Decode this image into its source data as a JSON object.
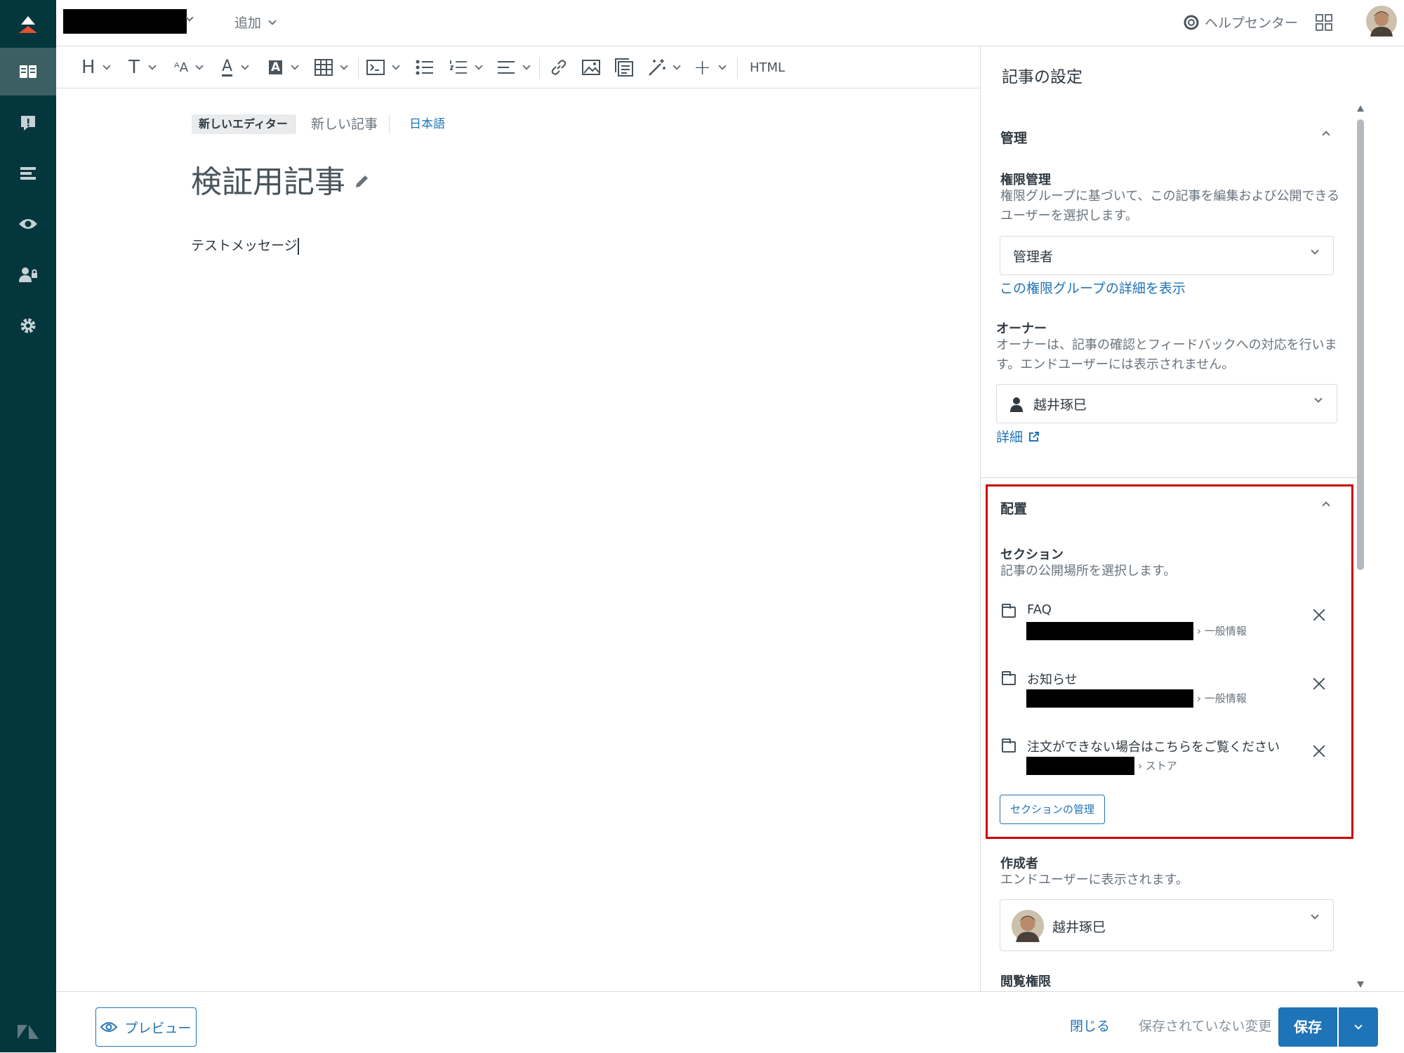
{
  "topbar": {
    "add_label": "追加",
    "help_label": "ヘルプセンター"
  },
  "toolbar": {
    "html_label": "HTML"
  },
  "editor": {
    "badge": "新しいエディター",
    "status": "新しい記事",
    "language": "日本語",
    "title": "検証用記事",
    "body": "テストメッセージ"
  },
  "panel": {
    "title": "記事の設定",
    "management": {
      "heading": "管理",
      "permission_label": "権限管理",
      "permission_desc": "権限グループに基づいて、この記事を編集および公開できるユーザーを選択します。",
      "permission_value": "管理者",
      "permission_link": "この権限グループの詳細を表示",
      "owner_label": "オーナー",
      "owner_desc": "オーナーは、記事の確認とフィードバックへの対応を行います。エンドユーザーには表示されません。",
      "owner_value": "越井琢巳",
      "owner_link": "詳細"
    },
    "placement": {
      "heading": "配置",
      "section_label": "セクション",
      "section_desc": "記事の公開場所を選択します。",
      "sections": [
        {
          "name": "FAQ",
          "path": "一般情報"
        },
        {
          "name": "お知らせ",
          "path": "一般情報"
        },
        {
          "name": "注文ができない場合はこちらをご覧ください",
          "path": "ストア"
        }
      ],
      "manage_button": "セクションの管理"
    },
    "author": {
      "label": "作成者",
      "desc": "エンドユーザーに表示されます。",
      "value": "越井琢巳"
    },
    "visibility": {
      "label": "閲覧権限"
    }
  },
  "bottom": {
    "preview": "プレビュー",
    "close": "閉じる",
    "unsaved": "保存されていない変更",
    "save": "保存"
  },
  "colors": {
    "sidebar": "#03363d",
    "accent": "#1f73b7",
    "highlight": "#cc0000"
  }
}
